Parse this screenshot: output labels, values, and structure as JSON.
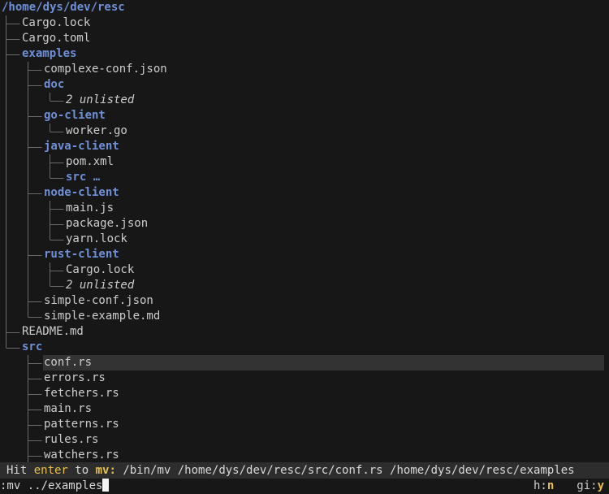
{
  "tree": {
    "root_path": "/home/dys/dev/resc",
    "lines": [
      {
        "name": "Cargo.lock",
        "type": "file",
        "depth": 1,
        "last": false,
        "ancestors_last": []
      },
      {
        "name": "Cargo.toml",
        "type": "file",
        "depth": 1,
        "last": false,
        "ancestors_last": []
      },
      {
        "name": "examples",
        "type": "dir",
        "depth": 1,
        "last": false,
        "ancestors_last": []
      },
      {
        "name": "complexe-conf.json",
        "type": "file",
        "depth": 2,
        "last": false,
        "ancestors_last": [
          false
        ]
      },
      {
        "name": "doc",
        "type": "dir",
        "depth": 2,
        "last": false,
        "ancestors_last": [
          false
        ]
      },
      {
        "name": "2 unlisted",
        "type": "unlisted",
        "depth": 3,
        "last": true,
        "ancestors_last": [
          false,
          false
        ]
      },
      {
        "name": "go-client",
        "type": "dir",
        "depth": 2,
        "last": false,
        "ancestors_last": [
          false
        ]
      },
      {
        "name": "worker.go",
        "type": "file",
        "depth": 3,
        "last": true,
        "ancestors_last": [
          false,
          false
        ]
      },
      {
        "name": "java-client",
        "type": "dir",
        "depth": 2,
        "last": false,
        "ancestors_last": [
          false
        ]
      },
      {
        "name": "pom.xml",
        "type": "file",
        "depth": 3,
        "last": false,
        "ancestors_last": [
          false,
          false
        ]
      },
      {
        "name": "src …",
        "type": "dir",
        "depth": 3,
        "last": true,
        "ancestors_last": [
          false,
          false
        ]
      },
      {
        "name": "node-client",
        "type": "dir",
        "depth": 2,
        "last": false,
        "ancestors_last": [
          false
        ]
      },
      {
        "name": "main.js",
        "type": "file",
        "depth": 3,
        "last": false,
        "ancestors_last": [
          false,
          false
        ]
      },
      {
        "name": "package.json",
        "type": "file",
        "depth": 3,
        "last": false,
        "ancestors_last": [
          false,
          false
        ]
      },
      {
        "name": "yarn.lock",
        "type": "file",
        "depth": 3,
        "last": true,
        "ancestors_last": [
          false,
          false
        ]
      },
      {
        "name": "rust-client",
        "type": "dir",
        "depth": 2,
        "last": false,
        "ancestors_last": [
          false
        ]
      },
      {
        "name": "Cargo.lock",
        "type": "file",
        "depth": 3,
        "last": false,
        "ancestors_last": [
          false,
          false
        ]
      },
      {
        "name": "2 unlisted",
        "type": "unlisted",
        "depth": 3,
        "last": true,
        "ancestors_last": [
          false,
          false
        ]
      },
      {
        "name": "simple-conf.json",
        "type": "file",
        "depth": 2,
        "last": false,
        "ancestors_last": [
          false
        ]
      },
      {
        "name": "simple-example.md",
        "type": "file",
        "depth": 2,
        "last": true,
        "ancestors_last": [
          false
        ]
      },
      {
        "name": "README.md",
        "type": "file",
        "depth": 1,
        "last": false,
        "ancestors_last": []
      },
      {
        "name": "src",
        "type": "dir",
        "depth": 1,
        "last": true,
        "ancestors_last": []
      },
      {
        "name": "conf.rs",
        "type": "file",
        "depth": 2,
        "last": false,
        "ancestors_last": [
          true
        ],
        "selected": true
      },
      {
        "name": "errors.rs",
        "type": "file",
        "depth": 2,
        "last": false,
        "ancestors_last": [
          true
        ]
      },
      {
        "name": "fetchers.rs",
        "type": "file",
        "depth": 2,
        "last": false,
        "ancestors_last": [
          true
        ]
      },
      {
        "name": "main.rs",
        "type": "file",
        "depth": 2,
        "last": false,
        "ancestors_last": [
          true
        ]
      },
      {
        "name": "patterns.rs",
        "type": "file",
        "depth": 2,
        "last": false,
        "ancestors_last": [
          true
        ]
      },
      {
        "name": "rules.rs",
        "type": "file",
        "depth": 2,
        "last": false,
        "ancestors_last": [
          true
        ]
      },
      {
        "name": "watchers.rs",
        "type": "file",
        "depth": 2,
        "last": false,
        "ancestors_last": [
          true
        ]
      }
    ]
  },
  "status": {
    "prefix": "Hit ",
    "key": "enter",
    "middle": " to ",
    "verb": "mv:",
    "command": " /bin/mv /home/dys/dev/resc/src/conf.rs /home/dys/dev/resc/examples"
  },
  "input": {
    "value": ":mv ../examples"
  },
  "flags": [
    {
      "key": "h:",
      "value": "n"
    },
    {
      "key": "gi:",
      "value": "y"
    }
  ],
  "colors": {
    "directory": "#6f8fd6",
    "file": "#cdcdcd",
    "highlight": "#e6c14a",
    "selection": "#333333",
    "background": "#171717"
  }
}
